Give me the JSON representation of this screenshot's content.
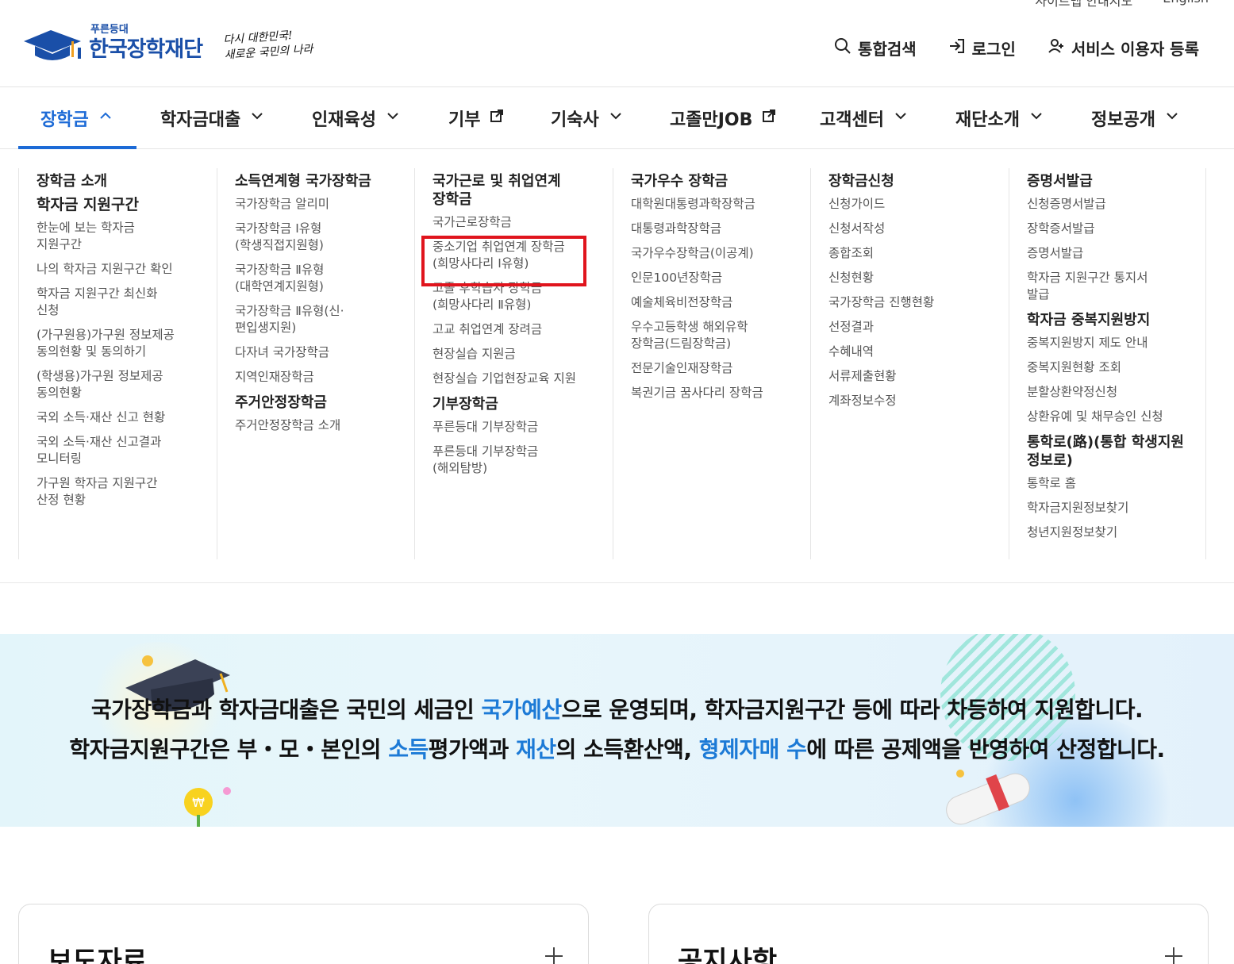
{
  "util": {
    "sitemap": "사이트맵 안내지도",
    "english": "English"
  },
  "logo": {
    "sub": "푸른등대",
    "main": "한국장학재단",
    "slogan_line1": "다시 대한민국!",
    "slogan_line2": "새로운 국민의 나라"
  },
  "header_actions": [
    {
      "label": "통합검색",
      "icon": "search-icon"
    },
    {
      "label": "로그인",
      "icon": "login-icon"
    },
    {
      "label": "서비스 이용자 등록",
      "icon": "user-add-icon"
    }
  ],
  "gnb": [
    {
      "label": "장학금",
      "icon": "chevron-up-icon",
      "active": true
    },
    {
      "label": "학자금대출",
      "icon": "chevron-down-icon"
    },
    {
      "label": "인재육성",
      "icon": "chevron-down-icon"
    },
    {
      "label": "기부",
      "icon": "external-link-icon"
    },
    {
      "label": "기숙사",
      "icon": "chevron-down-icon"
    },
    {
      "label": "고졸만JOB",
      "icon": "external-link-icon"
    },
    {
      "label": "고객센터",
      "icon": "chevron-down-icon"
    },
    {
      "label": "재단소개",
      "icon": "chevron-down-icon"
    },
    {
      "label": "정보공개",
      "icon": "chevron-down-icon"
    }
  ],
  "mega": {
    "col1": {
      "h1": "장학금 소개",
      "h2": "학자금 지원구간",
      "links": [
        "한눈에 보는 학자금\n지원구간",
        "나의 학자금 지원구간 확인",
        "학자금 지원구간 최신화\n신청",
        "(가구원용)가구원 정보제공\n동의현황 및 동의하기",
        "(학생용)가구원 정보제공\n동의현황",
        "국외 소득·재산 신고 현황",
        "국외 소득·재산 신고결과\n모니터링",
        "가구원 학자금 지원구간\n산정 현황"
      ]
    },
    "col2": {
      "h1": "소득연계형 국가장학금",
      "links": [
        "국가장학금 알리미",
        "국가장학금 Ⅰ유형\n(학생직접지원형)",
        "국가장학금 Ⅱ유형\n(대학연계지원형)",
        "국가장학금 Ⅱ유형(신·\n편입생지원)",
        "다자녀 국가장학금",
        "지역인재장학금"
      ],
      "h2": "주거안정장학금",
      "links2": [
        "주거안정장학금 소개"
      ]
    },
    "col3": {
      "h1": "국가근로 및 취업연계\n장학금",
      "links": [
        "국가근로장학금",
        "중소기업 취업연계 장학금\n(희망사다리 Ⅰ유형)",
        "고졸 후학습자 장학금\n(희망사다리 Ⅱ유형)",
        "고교 취업연계 장려금",
        "현장실습 지원금",
        "현장실습 기업현장교육 지원"
      ],
      "h2": "기부장학금",
      "links2": [
        "푸른등대 기부장학금",
        "푸른등대 기부장학금\n(해외탐방)"
      ]
    },
    "col4": {
      "h1": "국가우수 장학금",
      "links": [
        "대학원대통령과학장학금",
        "대통령과학장학금",
        "국가우수장학금(이공계)",
        "인문100년장학금",
        "예술체육비전장학금",
        "우수고등학생 해외유학\n장학금(드림장학금)",
        "전문기술인재장학금",
        "복권기금 꿈사다리 장학금"
      ]
    },
    "col5": {
      "h1": "장학금신청",
      "links": [
        "신청가이드",
        "신청서작성",
        "종합조회",
        "신청현황",
        "국가장학금 진행현황",
        "선정결과",
        "수혜내역",
        "서류제출현황",
        "계좌정보수정"
      ]
    },
    "col6": {
      "h1": "증명서발급",
      "links": [
        "신청증명서발급",
        "장학증서발급",
        "증명서발급",
        "학자금 지원구간 통지서\n발급"
      ],
      "h2": "학자금 중복지원방지",
      "links2": [
        "중복지원방지 제도 안내",
        "중복지원현황 조회",
        "분할상환약정신청",
        "상환유예 및 채무승인 신청"
      ],
      "h3": "통학로(路)(통합 학생지원\n정보로)",
      "links3": [
        "통학로 홈",
        "학자금지원정보찾기",
        "청년지원정보찾기"
      ]
    }
  },
  "banner": {
    "l1_a": "국가장학금과 학자금대출은 국민의 세금인 ",
    "l1_b": "국가예산",
    "l1_c": "으로 운영되며, 학자금지원구간 등에 따라 차등하여 지원합니다.",
    "l2_a": "학자금지원구간은 부・모・본인의 ",
    "l2_b": "소득",
    "l2_c": "평가액과 ",
    "l2_d": "재산",
    "l2_e": "의 소득환산액, ",
    "l2_f": "형제자매 수",
    "l2_g": "에 따른 공제액을 반영하여 산정합니다."
  },
  "boards": {
    "press": "보도자료",
    "notice": "공지사항"
  },
  "colors": {
    "brand": "#1a4fa8",
    "accent": "#1c6ad6",
    "highlight": "#e0141d"
  }
}
